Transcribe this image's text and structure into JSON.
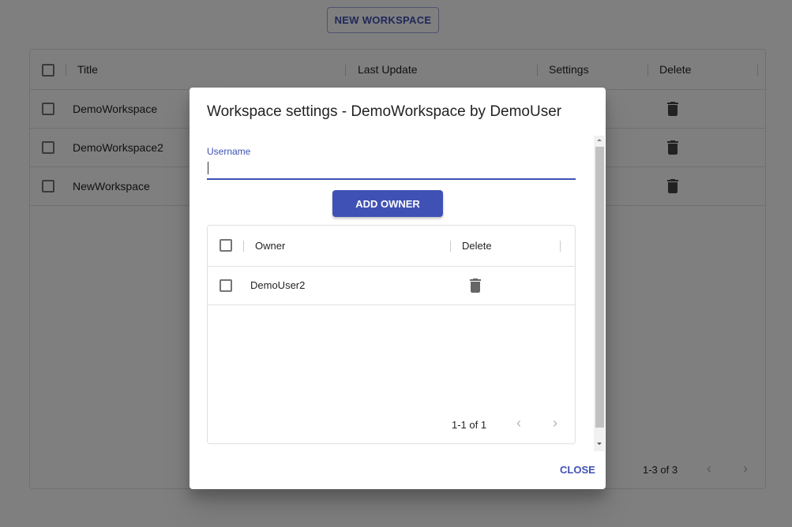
{
  "toolbar": {
    "new_workspace": "NEW WORKSPACE"
  },
  "workspaces": {
    "columns": [
      "Title",
      "Last Update",
      "Settings",
      "Delete"
    ],
    "rows": [
      {
        "title": "DemoWorkspace"
      },
      {
        "title": "DemoWorkspace2"
      },
      {
        "title": "NewWorkspace"
      }
    ],
    "pagination": "1-3 of 3"
  },
  "dialog": {
    "title": "Workspace settings - DemoWorkspace by DemoUser",
    "username_label": "Username",
    "username_value": "",
    "add_owner": "ADD OWNER",
    "owners": {
      "columns": [
        "Owner",
        "Delete"
      ],
      "rows": [
        {
          "owner": "DemoUser2"
        }
      ],
      "pagination": "1-1 of 1"
    },
    "close": "CLOSE"
  },
  "colors": {
    "primary": "#3f51b5"
  }
}
